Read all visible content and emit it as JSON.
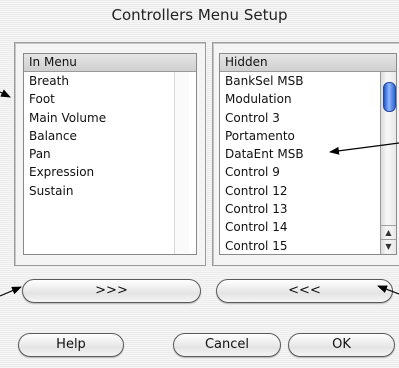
{
  "dialog": {
    "title": "Controllers Menu Setup"
  },
  "in_menu": {
    "header": "In Menu",
    "items": [
      "Breath",
      "Foot",
      "Main Volume",
      "Balance",
      "Pan",
      "Expression",
      "Sustain"
    ]
  },
  "hidden": {
    "header": "Hidden",
    "items": [
      "BankSel MSB",
      "Modulation",
      "Control 3",
      "Portamento",
      "DataEnt MSB",
      "Control 9",
      "Control 12",
      "Control 13",
      "Control 14",
      "Control 15"
    ]
  },
  "buttons": {
    "add": ">>>",
    "remove": "<<<",
    "help": "Help",
    "cancel": "Cancel",
    "ok": "OK"
  },
  "scrollbar": {
    "up_arrow": "▲",
    "down_arrow": "▼"
  },
  "colors": {
    "scroll_thumb": "#2c64d6",
    "callout_line": "#000000"
  },
  "icons": [
    "callout-arrow-icon"
  ]
}
